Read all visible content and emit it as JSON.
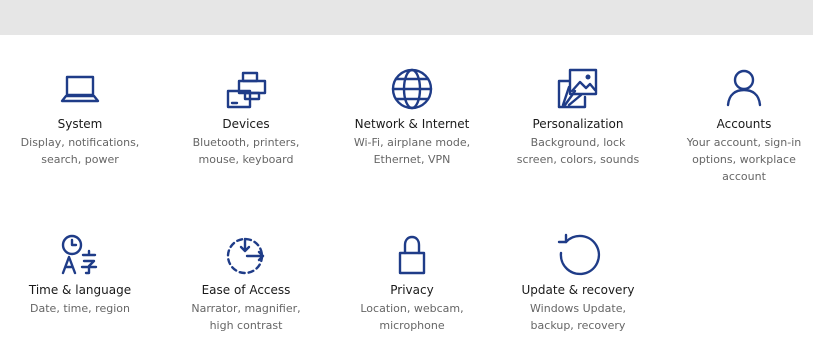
{
  "colors": {
    "icon_blue": "#1f3c88",
    "title_text": "#1a1a1a",
    "desc_text": "#666666",
    "topbar_bg": "#e6e6e6"
  },
  "tiles": [
    {
      "icon": "laptop-icon",
      "title": "System",
      "desc": "Display, notifications, search, power"
    },
    {
      "icon": "devices-icon",
      "title": "Devices",
      "desc": "Bluetooth, printers, mouse, keyboard"
    },
    {
      "icon": "globe-icon",
      "title": "Network & Internet",
      "desc": "Wi-Fi, airplane mode, Ethernet, VPN"
    },
    {
      "icon": "personalization-icon",
      "title": "Personalization",
      "desc": "Background, lock screen, colors, sounds"
    },
    {
      "icon": "person-icon",
      "title": "Accounts",
      "desc": "Your account, sign-in options, workplace account"
    },
    {
      "icon": "time-language-icon",
      "title": "Time & language",
      "desc": "Date, time, region"
    },
    {
      "icon": "ease-of-access-icon",
      "title": "Ease of Access",
      "desc": "Narrator, magnifier, high contrast"
    },
    {
      "icon": "lock-icon",
      "title": "Privacy",
      "desc": "Location, webcam, microphone"
    },
    {
      "icon": "refresh-icon",
      "title": "Update & recovery",
      "desc": "Windows Update, backup, recovery"
    }
  ]
}
